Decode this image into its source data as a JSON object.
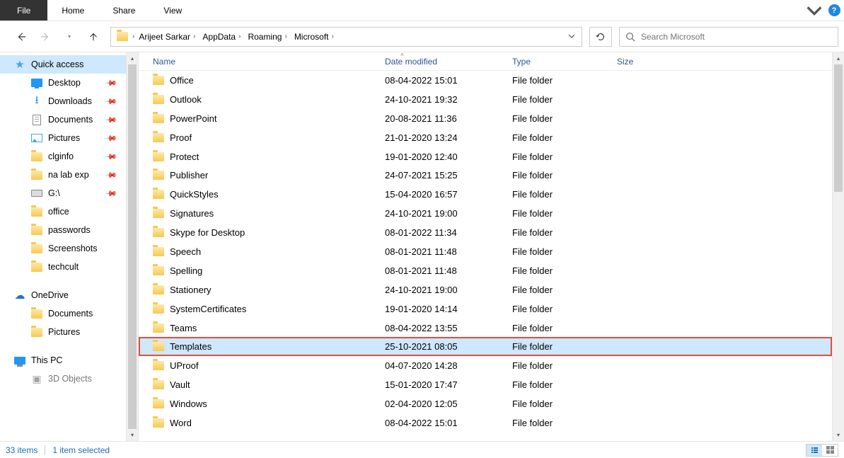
{
  "ribbon": {
    "file": "File",
    "tabs": [
      "Home",
      "Share",
      "View"
    ]
  },
  "breadcrumbs": [
    "Arijeet Sarkar",
    "AppData",
    "Roaming",
    "Microsoft"
  ],
  "search": {
    "placeholder": "Search Microsoft"
  },
  "sidebar": {
    "quick_access": "Quick access",
    "pinned": [
      {
        "label": "Desktop",
        "icon": "desktop"
      },
      {
        "label": "Downloads",
        "icon": "downloads"
      },
      {
        "label": "Documents",
        "icon": "documents"
      },
      {
        "label": "Pictures",
        "icon": "pictures"
      },
      {
        "label": "clginfo",
        "icon": "folder"
      },
      {
        "label": "na lab exp",
        "icon": "folder"
      },
      {
        "label": "G:\\",
        "icon": "drive"
      }
    ],
    "recent": [
      {
        "label": "office"
      },
      {
        "label": "passwords"
      },
      {
        "label": "Screenshots"
      },
      {
        "label": "techcult"
      }
    ],
    "onedrive": "OneDrive",
    "onedrive_children": [
      "Documents",
      "Pictures"
    ],
    "this_pc": "This PC",
    "pc_children": [
      "3D Objects"
    ]
  },
  "columns": {
    "name": "Name",
    "date": "Date modified",
    "type": "Type",
    "size": "Size"
  },
  "files": [
    {
      "name": "Office",
      "date": "08-04-2022 15:01",
      "type": "File folder"
    },
    {
      "name": "Outlook",
      "date": "24-10-2021 19:32",
      "type": "File folder"
    },
    {
      "name": "PowerPoint",
      "date": "20-08-2021 11:36",
      "type": "File folder"
    },
    {
      "name": "Proof",
      "date": "21-01-2020 13:24",
      "type": "File folder"
    },
    {
      "name": "Protect",
      "date": "19-01-2020 12:40",
      "type": "File folder"
    },
    {
      "name": "Publisher",
      "date": "24-07-2021 15:25",
      "type": "File folder"
    },
    {
      "name": "QuickStyles",
      "date": "15-04-2020 16:57",
      "type": "File folder"
    },
    {
      "name": "Signatures",
      "date": "24-10-2021 19:00",
      "type": "File folder"
    },
    {
      "name": "Skype for Desktop",
      "date": "08-01-2022 11:34",
      "type": "File folder"
    },
    {
      "name": "Speech",
      "date": "08-01-2021 11:48",
      "type": "File folder"
    },
    {
      "name": "Spelling",
      "date": "08-01-2021 11:48",
      "type": "File folder"
    },
    {
      "name": "Stationery",
      "date": "24-10-2021 19:00",
      "type": "File folder"
    },
    {
      "name": "SystemCertificates",
      "date": "19-01-2020 14:14",
      "type": "File folder"
    },
    {
      "name": "Teams",
      "date": "08-04-2022 13:55",
      "type": "File folder"
    },
    {
      "name": "Templates",
      "date": "25-10-2021 08:05",
      "type": "File folder",
      "selected": true,
      "highlighted": true
    },
    {
      "name": "UProof",
      "date": "04-07-2020 14:28",
      "type": "File folder"
    },
    {
      "name": "Vault",
      "date": "15-01-2020 17:47",
      "type": "File folder"
    },
    {
      "name": "Windows",
      "date": "02-04-2020 12:05",
      "type": "File folder"
    },
    {
      "name": "Word",
      "date": "08-04-2022 15:01",
      "type": "File folder"
    }
  ],
  "status": {
    "count": "33 items",
    "selection": "1 item selected"
  }
}
